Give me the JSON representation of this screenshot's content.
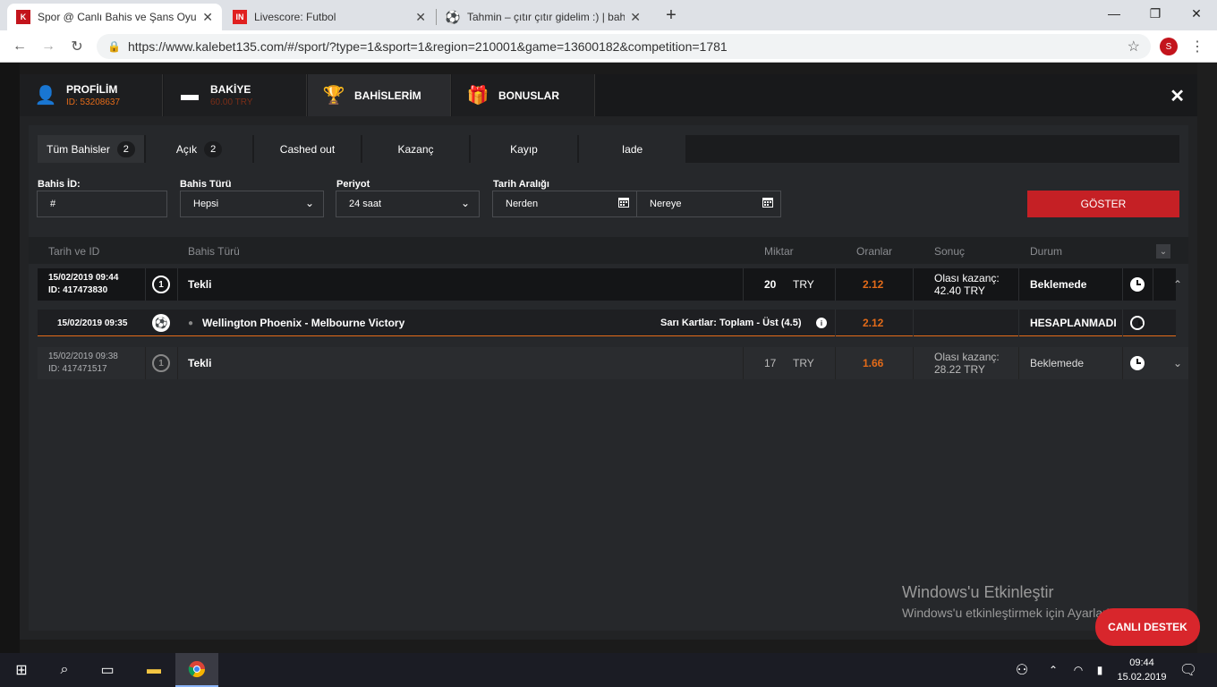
{
  "browser": {
    "tabs": [
      {
        "title": "Spor @ Canlı Bahis ve Şans Oyun",
        "favicon": "K"
      },
      {
        "title": "Livescore: Futbol",
        "favicon": "IN"
      },
      {
        "title": "Tahmin – çıtır çıtır gidelim :) | bah",
        "favicon": "⚽"
      }
    ],
    "url": "https://www.kalebet135.com/#/sport/?type=1&sport=1&region=210001&game=13600182&competition=1781",
    "profile_initial": "S"
  },
  "modal": {
    "tabs": [
      {
        "title": "PROFİLİM",
        "sub": "ID: 53208637"
      },
      {
        "title": "BAKİYE",
        "sub": "60.00 TRY"
      },
      {
        "title": "BAHİSLERİM",
        "sub": ""
      },
      {
        "title": "BONUSLAR",
        "sub": ""
      }
    ],
    "subtabs": [
      {
        "label": "Tüm Bahisler",
        "count": "2"
      },
      {
        "label": "Açık",
        "count": "2"
      },
      {
        "label": "Cashed out"
      },
      {
        "label": "Kazanç"
      },
      {
        "label": "Kayıp"
      },
      {
        "label": "Iade"
      }
    ],
    "filters": {
      "bet_id_label": "Bahis İD:",
      "bet_id_placeholder": "#",
      "bet_type_label": "Bahis Türü",
      "bet_type_value": "Hepsi",
      "period_label": "Periyot",
      "period_value": "24 saat",
      "date_range_label": "Tarih Aralığı",
      "from_placeholder": "Nerden",
      "to_placeholder": "Nereye",
      "show_button": "GÖSTER"
    },
    "table": {
      "headers": [
        "Tarih ve ID",
        "Bahis Türü",
        "Miktar",
        "Oranlar",
        "Sonuç",
        "Durum"
      ],
      "bets": [
        {
          "date": "15/02/2019 09:44",
          "id": "ID: 417473830",
          "type": "Tekli",
          "amount": "20",
          "currency": "TRY",
          "odds": "2.12",
          "result_label": "Olası kazanç:",
          "result_value": "42.40 TRY",
          "status": "Beklemede"
        },
        {
          "date": "15/02/2019 09:38",
          "id": "ID: 417471517",
          "type": "Tekli",
          "amount": "17",
          "currency": "TRY",
          "odds": "1.66",
          "result_label": "Olası kazanç:",
          "result_value": "28.22 TRY",
          "status": "Beklemede"
        }
      ],
      "detail": {
        "date": "15/02/2019 09:35",
        "event": "Wellington Phoenix - Melbourne Victory",
        "market": "Sarı Kartlar: Toplam - Üst (4.5)",
        "odds": "2.12",
        "status": "HESAPLANMADI"
      }
    }
  },
  "overlay": {
    "watermark_title": "Windows'u Etkinleştir",
    "watermark_sub": "Windows'u etkinleştirmek için Ayarlar'a gidin.",
    "live_support": "CANLI DESTEK"
  },
  "taskbar": {
    "time": "09:44",
    "date": "15.02.2019"
  },
  "colors": {
    "accent": "#e36b19",
    "button": "#c52025"
  }
}
